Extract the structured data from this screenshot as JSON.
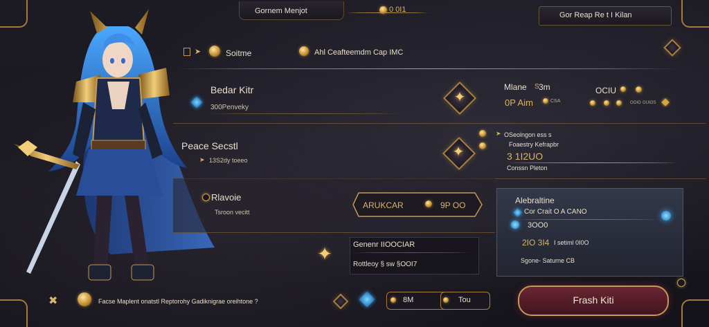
{
  "header": {
    "title": "Gornem Menjot",
    "currency": "0 0I1",
    "top_right": "Gor Reap Re t I Kilan"
  },
  "summary": {
    "label": "Soitme",
    "recommend": "Ahl Ceafteemdm Cap IMC"
  },
  "rows": {
    "row1": {
      "title": "Bedar Kitr",
      "sub": "300Penveky"
    },
    "row2": {
      "title": "Peace Secstl",
      "sub": "13S2dy toeeo"
    },
    "row3": {
      "title": "Rlavoie",
      "sub": "Tsroon vecitt"
    }
  },
  "stats": {
    "mlane_label": "Mlane",
    "mlane_sub": "S",
    "mlane_value": "3m",
    "aim_label": "0P Aim",
    "oclu_label": "OCIU",
    "stat_tiny_1": "CSA",
    "stat_tiny_2": "OOIO",
    "stat_tiny_3": "GUIOS"
  },
  "mid_info": {
    "line1": "OSeolngon ess s",
    "line2": "Foaestry Kefrapbr",
    "number": "3 1I2UO",
    "line3": "Conssn Pleton"
  },
  "arrow_panel": {
    "label": "ARUKCAR",
    "value": "9P OO"
  },
  "details": {
    "title": "Alebraltine",
    "line1": "Cor Crait O A CANO",
    "value1": "3OO0",
    "value2": "2IO 3I4",
    "value2b": "I setiml 0I0O",
    "footer": "Sgone- Saturne CB"
  },
  "mini_panel": {
    "line1": "Genenr IIOOCIAR",
    "line2": "Rottleoy § sw §OOI7"
  },
  "bottom": {
    "hint": "Facse Maplent onatstl Reptorohy Gadiknigrae oreihtone ?",
    "btn_a": "8M",
    "btn_b": "Tou",
    "primary_button": "Frash Kiti"
  },
  "colors": {
    "accent": "#d9b46a",
    "gem": "#3aa9ff",
    "button": "#6b2532",
    "bg": "#17151d"
  }
}
